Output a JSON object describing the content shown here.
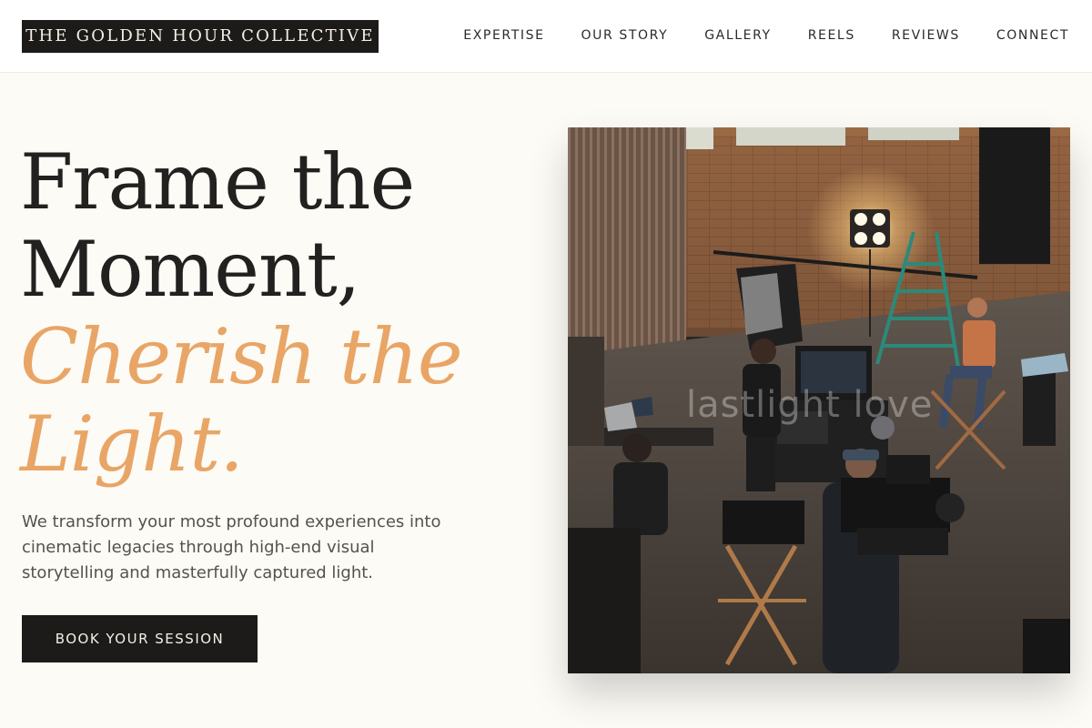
{
  "header": {
    "logo": "THE GOLDEN HOUR COLLECTIVE",
    "nav": [
      "EXPERTISE",
      "OUR STORY",
      "GALLERY",
      "REELS",
      "REVIEWS",
      "CONNECT"
    ]
  },
  "hero": {
    "title_line1": "Frame the",
    "title_line2": "Moment,",
    "title_accent1": "Cherish the",
    "title_accent2": "Light.",
    "description": "We transform your most profound experiences into cinematic legacies through high-end visual storytelling and masterfully captured light.",
    "cta_label": "BOOK YOUR SESSION"
  },
  "image": {
    "watermark": "lastlight love"
  },
  "colors": {
    "accent": "#e9a566",
    "dark": "#1d1b19",
    "background": "#fcfbf6"
  }
}
